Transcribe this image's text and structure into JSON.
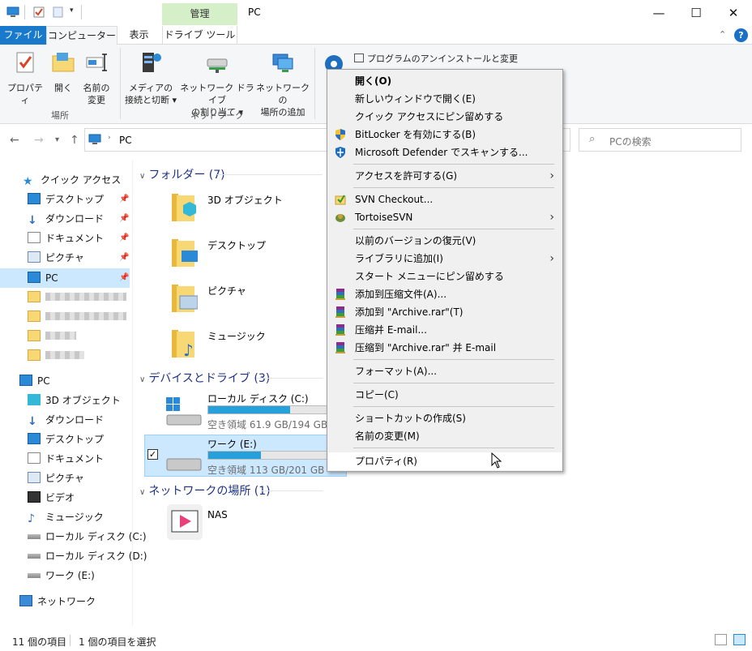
{
  "window": {
    "title": "PC",
    "context_tab": "管理",
    "controls": {
      "minimize": "—",
      "maximize": "☐",
      "close": "✕"
    }
  },
  "tabs": {
    "file": "ファイル",
    "computer": "コンピューター",
    "view": "表示",
    "drive_tools": "ドライブ ツール"
  },
  "help": "?",
  "ribbon": {
    "location_group": "場所",
    "network_group": "ネットワーク",
    "properties": "プロパティ",
    "open": "開く",
    "rename_1": "名前の",
    "rename_2": "変更",
    "media_1": "メディアの",
    "media_2": "接続と切断 ▾",
    "map_drive_1": "ネットワーク ドライブ",
    "map_drive_2": "の割り当て ▾",
    "add_location_1": "ネットワークの",
    "add_location_2": "場所の追加",
    "uninstall": "プログラムのアンインストールと変更"
  },
  "address": {
    "path": "PC",
    "search_placeholder": "PCの検索"
  },
  "nav": {
    "quick_access": "クイック アクセス",
    "qa_items": [
      "デスクトップ",
      "ダウンロード",
      "ドキュメント",
      "ピクチャ",
      "PC"
    ],
    "pc": "PC",
    "pc_items": [
      "3D オブジェクト",
      "ダウンロード",
      "デスクトップ",
      "ドキュメント",
      "ピクチャ",
      "ビデオ",
      "ミュージック",
      "ローカル ディスク (C:)",
      "ローカル ディスク (D:)",
      "ワーク (E:)"
    ],
    "network": "ネットワーク"
  },
  "content": {
    "folders_header": "フォルダー (7)",
    "folders": [
      "3D オブジェクト",
      "デスクトップ",
      "ピクチャ",
      "ミュージック"
    ],
    "devices_header": "デバイスとドライブ (3)",
    "drives": [
      {
        "name": "ローカル ディスク (C:)",
        "free": "空き領域 61.9 GB/194 GB",
        "used_fraction": 0.68
      },
      {
        "name": "ワーク (E:)",
        "free": "空き領域 113 GB/201 GB",
        "used_fraction": 0.44
      }
    ],
    "network_header": "ネットワークの場所 (1)",
    "network_items": [
      "NAS"
    ]
  },
  "status": {
    "items": "11 個の項目",
    "selected": "1 個の項目を選択"
  },
  "context_menu": {
    "open": "開く(O)",
    "new_window": "新しいウィンドウで開く(E)",
    "pin_quick": "クイック アクセスにピン留めする",
    "bitlocker": "BitLocker を有効にする(B)",
    "defender": "Microsoft Defender でスキャンする...",
    "give_access": "アクセスを許可する(G)",
    "svn_checkout": "SVN Checkout...",
    "tortoise": "TortoiseSVN",
    "restore": "以前のバージョンの復元(V)",
    "library": "ライブラリに追加(I)",
    "pin_start": "スタート メニューにピン留めする",
    "rar_add": "添加到压缩文件(A)...",
    "rar_add_archive": "添加到 \"Archive.rar\"(T)",
    "rar_email": "压缩并 E-mail...",
    "rar_archive_email": "压缩到 \"Archive.rar\" 并 E-mail",
    "format": "フォーマット(A)...",
    "copy": "コピー(C)",
    "shortcut": "ショートカットの作成(S)",
    "rename": "名前の変更(M)",
    "properties": "プロパティ(R)"
  },
  "colors": {
    "accent": "#1979ca",
    "selection": "#cce8ff",
    "drive_bar": "#26a0da"
  }
}
